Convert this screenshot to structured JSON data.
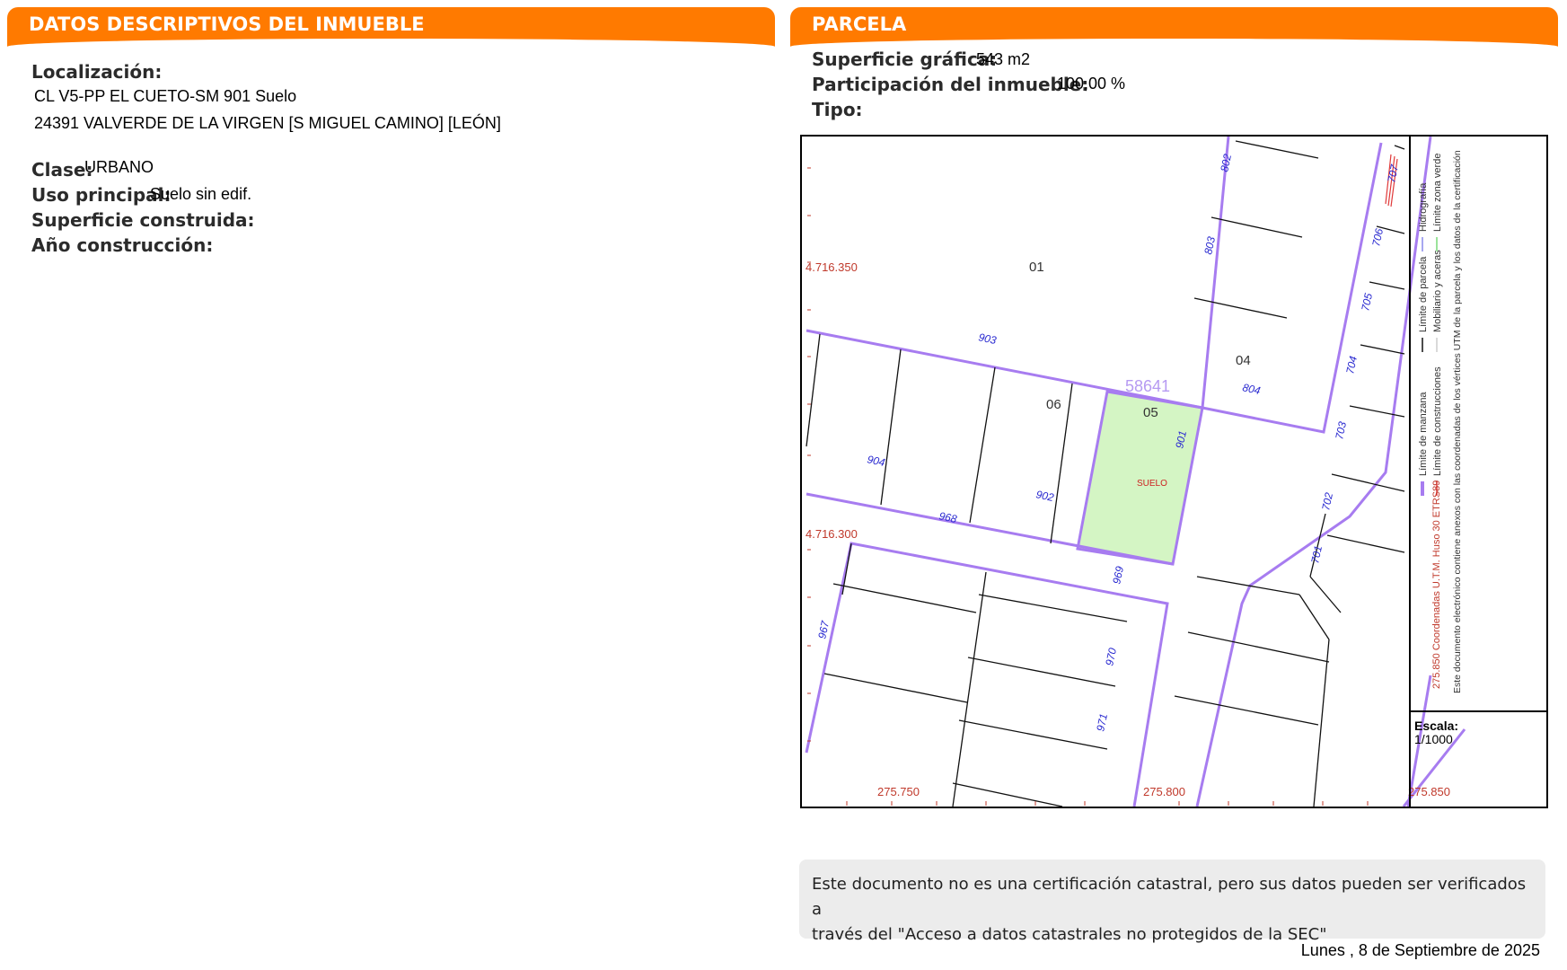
{
  "left": {
    "header": "DATOS DESCRIPTIVOS DEL INMUEBLE",
    "localizacion_label": "Localización:",
    "address_line1": "CL V5-PP EL CUETO-SM 901 Suelo",
    "address_line2": "24391 VALVERDE DE LA VIRGEN [S MIGUEL CAMINO] [LEÓN]",
    "clase_label": "Clase:",
    "clase_value": "URBANO",
    "uso_label": "Uso principal:",
    "uso_value": "Suelo sin edif.",
    "sup_construida_label": "Superficie construida:",
    "anio_label": "Año construcción:"
  },
  "right": {
    "header": "PARCELA",
    "sup_grafica_label": "Superficie gráfica:",
    "sup_grafica_value": "543 m2",
    "participacion_label": "Participación del inmueble:",
    "participacion_value": "100,00 %",
    "tipo_label": "Tipo:"
  },
  "map": {
    "y_label_1": "4.716.350",
    "y_label_2": "4.716.300",
    "x_label_1": "275.750",
    "x_label_2": "275.800",
    "x_label_3": "275.850",
    "block_number": "58641",
    "parcel_labels": [
      "01",
      "06",
      "05",
      "04"
    ],
    "parcel_use": "SUELO",
    "numbers": [
      "802",
      "803",
      "903",
      "904",
      "902",
      "901",
      "804",
      "968",
      "967",
      "969",
      "970",
      "971",
      "707",
      "706",
      "705",
      "704",
      "703",
      "702",
      "701"
    ],
    "legend": {
      "col1": [
        "Límite de manzana",
        "Límite de parcela",
        "Hidrografía"
      ],
      "col2": [
        "Límite de construcciones",
        "Mobiliario y aceras",
        "Límite zona verde"
      ],
      "coords": "275.850 Coordenadas U.T.M. Huso 30 ETRS89",
      "note": "Este documento electrónico contiene anexos con las coordenadas de los vértices UTM de la parcela y los datos de la certificación",
      "escala_label": "Escala:",
      "escala_value": "1/1000"
    },
    "colors": {
      "manzana": "#a77cf0",
      "highlight": "#d4f5c4",
      "coord_text": "#c0392b",
      "number_text": "#2a2ad0"
    }
  },
  "note": {
    "line1": "Este documento no es una certificación catastral, pero sus datos pueden ser verificados a",
    "line2": "través del \"Acceso a datos catastrales no protegidos de la SEC\""
  },
  "date": "Lunes , 8 de Septiembre de 2025"
}
